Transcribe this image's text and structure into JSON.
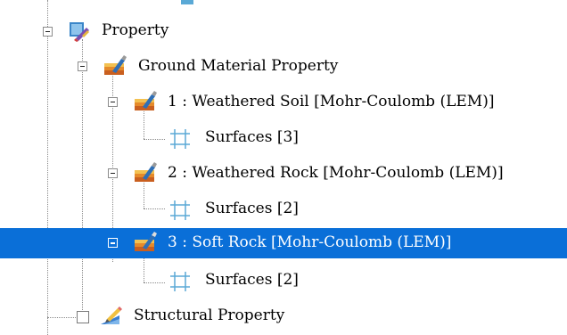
{
  "tree": {
    "items": [
      {
        "label": "Property",
        "icon": "property-folder-icon",
        "expanded": true
      },
      {
        "label": "Ground Material Property",
        "icon": "material-brush-icon",
        "expanded": true
      },
      {
        "label": "1 : Weathered Soil [Mohr-Coulomb (LEM)]",
        "icon": "material-brush-icon",
        "expanded": true
      },
      {
        "label": "Surfaces [3]",
        "icon": "surface-grid-icon"
      },
      {
        "label": "2 : Weathered Rock [Mohr-Coulomb (LEM)]",
        "icon": "material-brush-icon",
        "expanded": true
      },
      {
        "label": "Surfaces [2]",
        "icon": "surface-grid-icon"
      },
      {
        "label": "3 : Soft Rock [Mohr-Coulomb (LEM)]",
        "icon": "material-brush-icon",
        "expanded": true,
        "selected": true
      },
      {
        "label": "Surfaces [2]",
        "icon": "surface-grid-icon"
      },
      {
        "label": "Structural Property",
        "icon": "structural-edit-icon",
        "checked": false
      }
    ]
  },
  "colors": {
    "selection": "#0a6fd8",
    "tree_lines": "#8a8a8a",
    "surface_icon": "#5aa9d6"
  }
}
